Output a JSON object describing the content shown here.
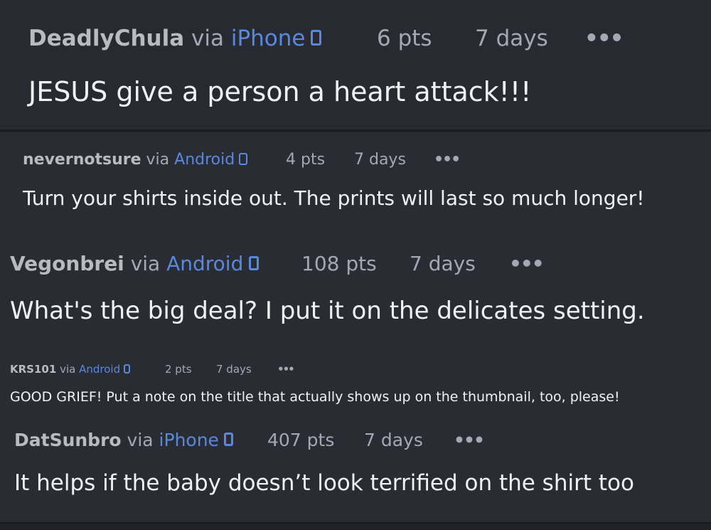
{
  "comments": [
    {
      "user": "DeadlyChula",
      "via": "via",
      "device": "iPhone",
      "points": "6 pts",
      "time": "7 days",
      "more": "•••",
      "text": "JESUS give a person a heart attack!!!"
    },
    {
      "user": "nevernotsure",
      "via": "via",
      "device": "Android",
      "points": "4 pts",
      "time": "7 days",
      "more": "•••",
      "text": "Turn your shirts inside out. The prints will last so much longer!"
    },
    {
      "user": "Vegonbrei",
      "via": "via",
      "device": "Android",
      "points": "108 pts",
      "time": "7 days",
      "more": "•••",
      "text": "What's the big deal? I put it on the delicates setting."
    },
    {
      "user": "KRS101",
      "via": "via",
      "device": "Android",
      "points": "2 pts",
      "time": "7 days",
      "more": "•••",
      "text": "GOOD GRIEF! Put a note on the title that actually shows up on the thumbnail, too, please!"
    },
    {
      "user": "DatSunbro",
      "via": "via",
      "device": "iPhone",
      "points": "407 pts",
      "time": "7 days",
      "more": "•••",
      "text": "It helps if the baby doesn’t look terrified on the shirt too"
    }
  ],
  "colors": {
    "background": "#1f2128",
    "card": "#2a2c33",
    "device_link": "#5a88dd",
    "meta_text": "#a5a8b0",
    "body_text": "#f1f2f4"
  },
  "icons": {
    "device": "phone-icon",
    "more": "more-options-icon"
  }
}
